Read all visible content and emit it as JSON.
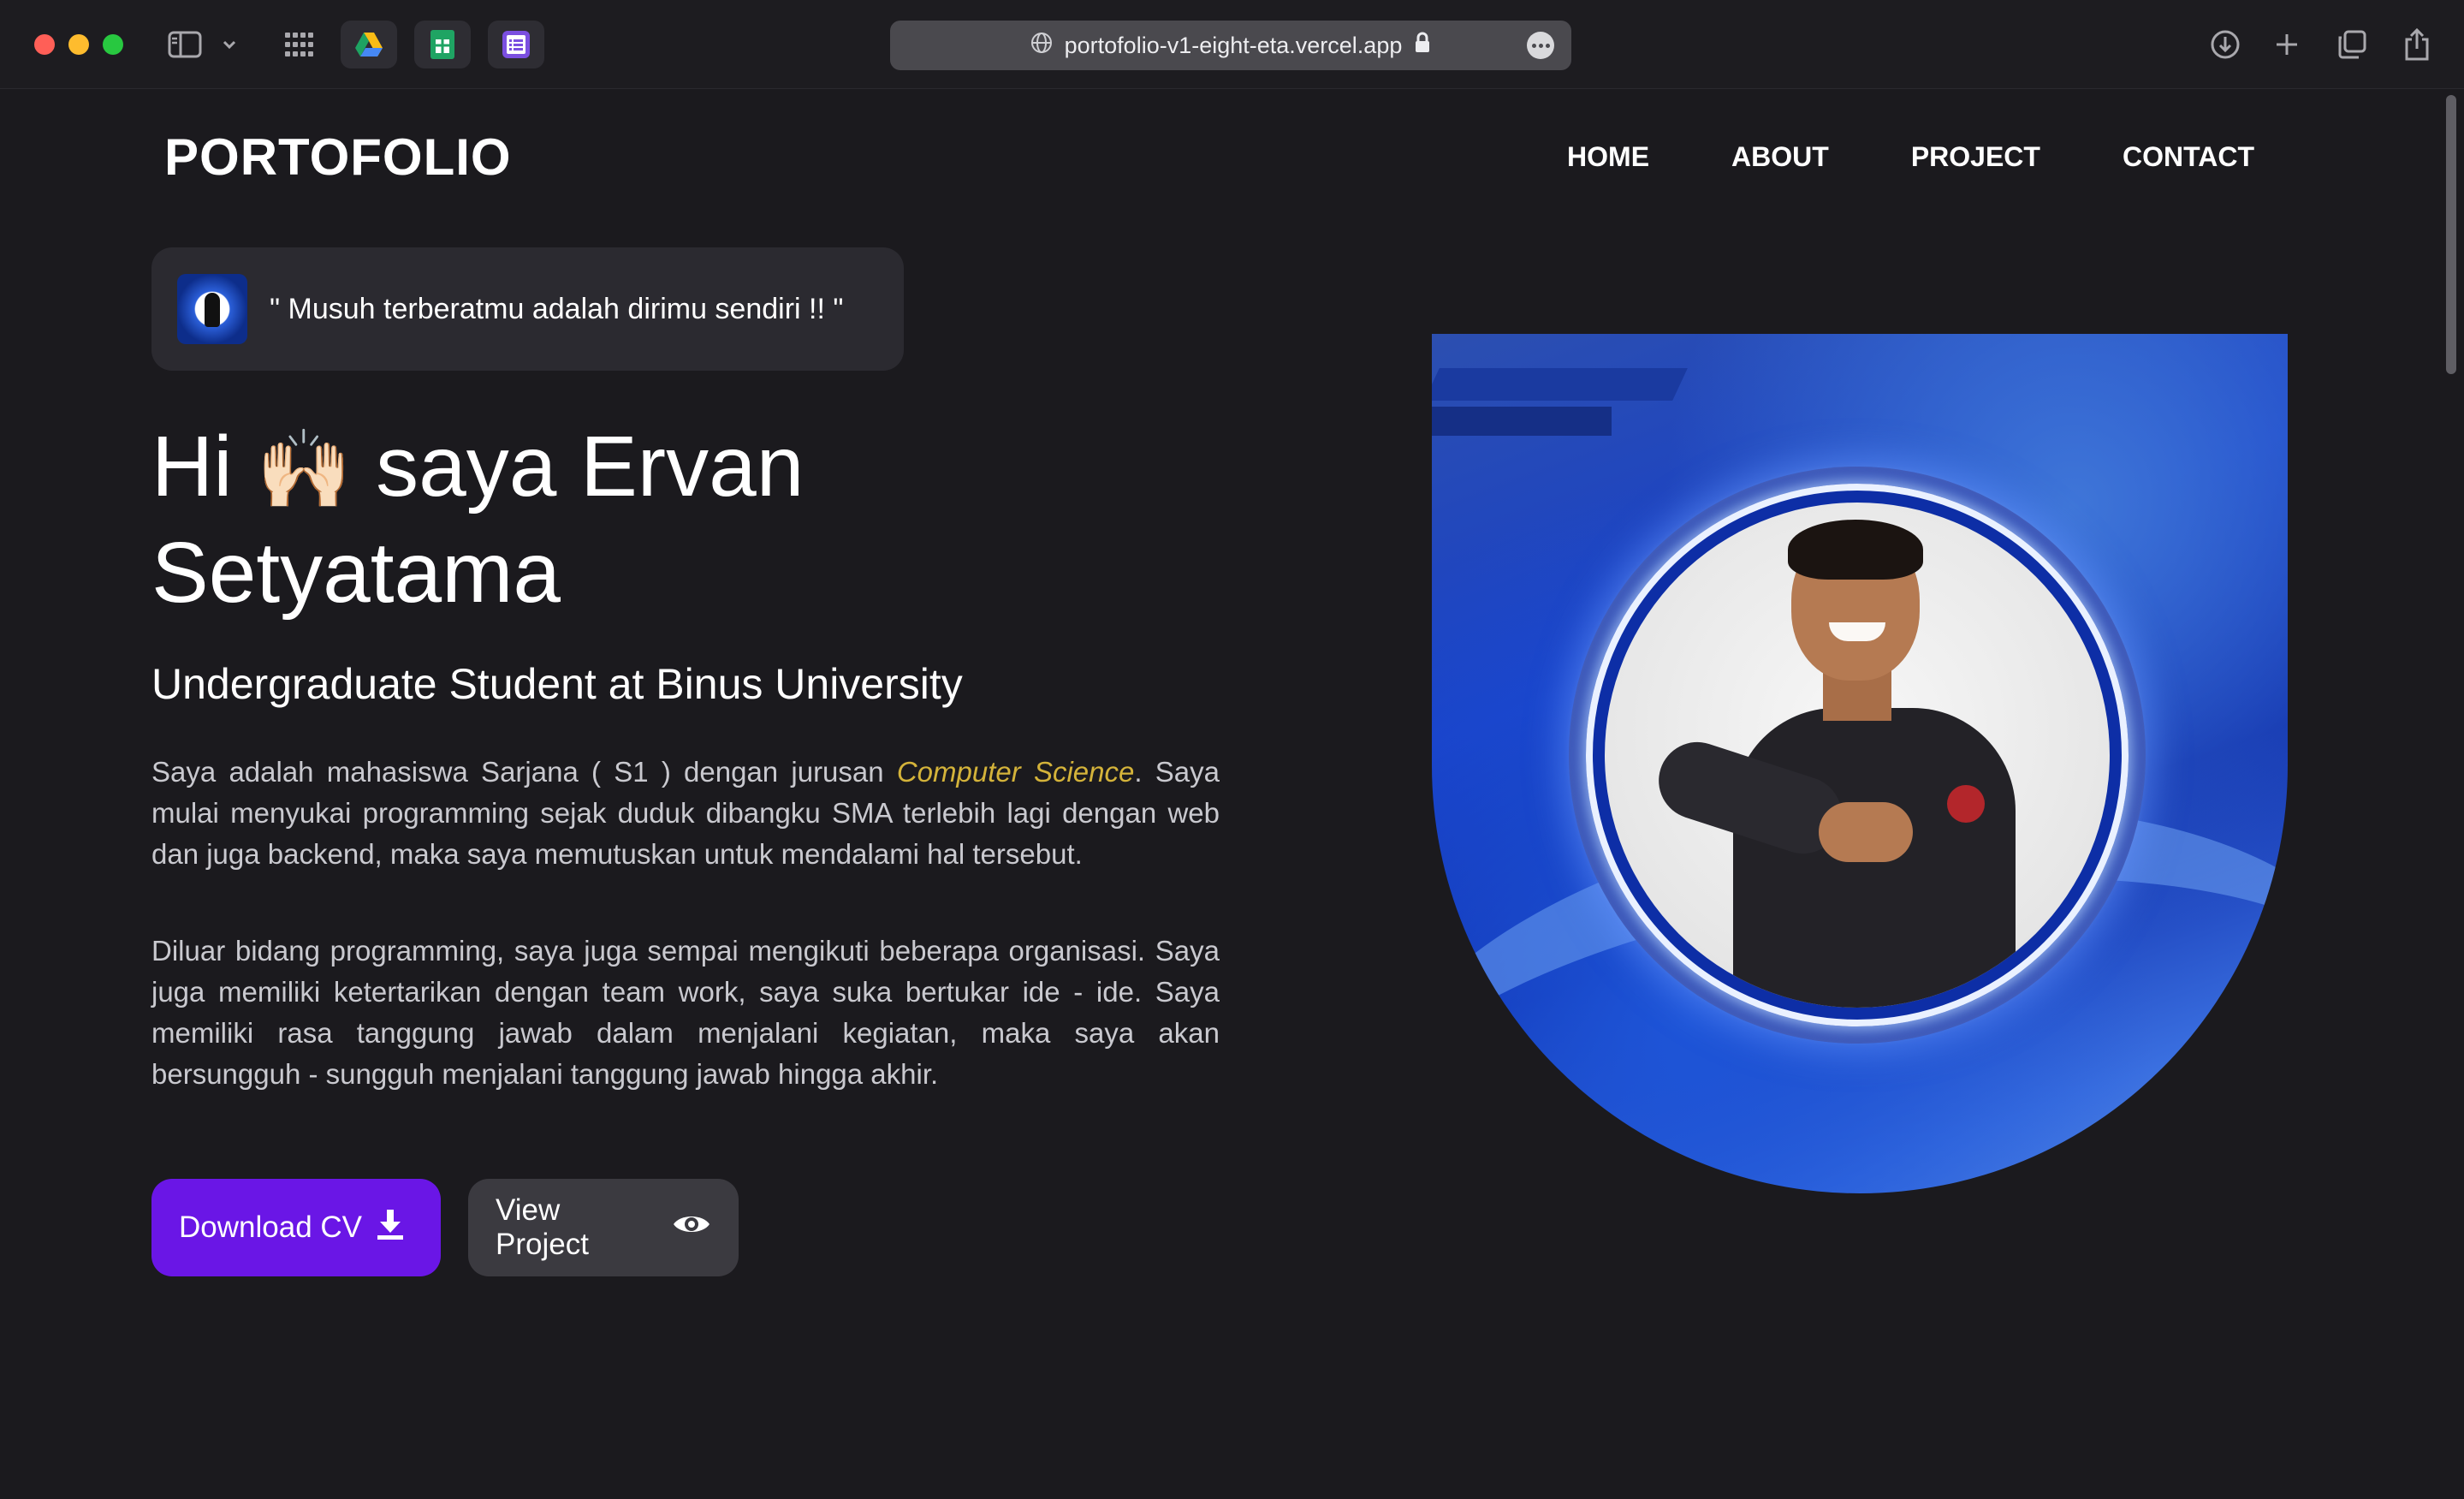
{
  "browser": {
    "url": "portofolio-v1-eight-eta.vercel.app",
    "toolbar_icons": [
      "sidebar-icon",
      "chevron-down-icon",
      "grid-icon",
      "google-drive-icon",
      "google-sheets-icon",
      "google-forms-icon"
    ],
    "right_icons": [
      "download-icon",
      "plus-icon",
      "tabs-overview-icon",
      "share-icon"
    ]
  },
  "site": {
    "brand": "PORTOFOLIO",
    "nav": [
      "HOME",
      "ABOUT",
      "PROJECT",
      "CONTACT"
    ]
  },
  "hero": {
    "quote": "\" Musuh terberatmu adalah dirimu sendiri !! \"",
    "greeting": "Hi",
    "emoji": "🙌🏻",
    "name_line1": "saya Ervan",
    "name_line2": "Setyatama",
    "subtitle": "Undergraduate Student at Binus University",
    "para1_before": "Saya adalah mahasiswa Sarjana ( S1 ) dengan jurusan ",
    "para1_highlight": "Computer Science",
    "para1_after": ". Saya mulai menyukai programming sejak duduk dibangku SMA terlebih lagi dengan web dan juga backend, maka saya memutuskan untuk mendalami hal tersebut.",
    "para2": "Diluar bidang programming, saya juga sempai mengikuti beberapa organisasi. Saya juga memiliki ketertarikan dengan team work, saya suka bertukar ide - ide. Saya memiliki rasa tanggung jawab dalam menjalani kegiatan, maka saya akan bersungguh - sungguh menjalani tanggung jawab hingga akhir.",
    "download_label": "Download CV",
    "view_label": "View Project"
  },
  "colors": {
    "background": "#1b1a1e",
    "primary_button": "#6a16e6",
    "secondary_button": "#3b3a40",
    "highlight": "#d4b33a"
  }
}
